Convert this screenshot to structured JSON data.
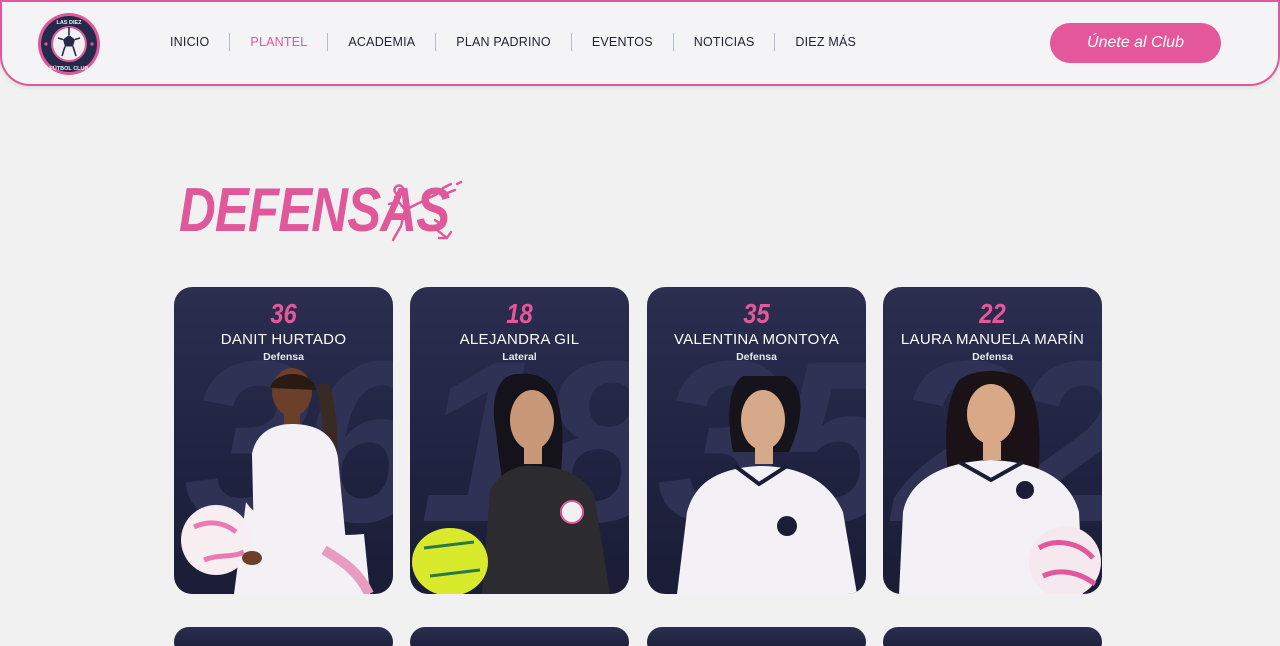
{
  "nav": {
    "logo_text_top": "LAS DIEZ",
    "logo_text_bottom": "FÚTBOL CLUB",
    "items": [
      "INICIO",
      "PLANTEL",
      "ACADEMIA",
      "PLAN PADRINO",
      "EVENTOS",
      "NOTICIAS",
      "DIEZ MÁS"
    ],
    "active": "PLANTEL",
    "cta": "Únete al Club"
  },
  "section": {
    "title": "DEFENSAS"
  },
  "players": [
    {
      "number": "36",
      "name": "DANIT HURTADO",
      "position": "Defensa",
      "jersey": "white",
      "ball": "pink"
    },
    {
      "number": "18",
      "name": "ALEJANDRA GIL",
      "position": "Lateral",
      "jersey": "dark",
      "ball": "yellow"
    },
    {
      "number": "35",
      "name": "VALENTINA MONTOYA",
      "position": "Defensa",
      "jersey": "white",
      "ball": "none"
    },
    {
      "number": "22",
      "name": "LAURA MANUELA MARÍN",
      "position": "Defensa",
      "jersey": "white",
      "ball": "pink"
    }
  ],
  "colors": {
    "accent": "#e0579a",
    "card": "#202341",
    "bg": "#f1f1f2"
  }
}
